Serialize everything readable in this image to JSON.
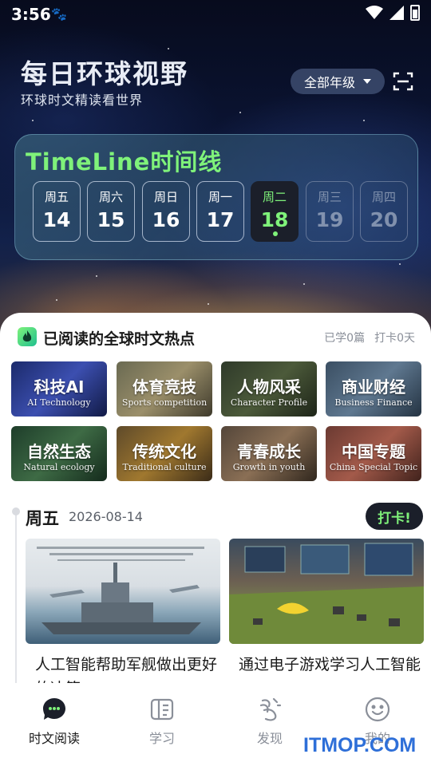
{
  "status_bar": {
    "time": "3:56"
  },
  "header": {
    "title": "每日环球视野",
    "subtitle": "环球时文精读看世界",
    "grade_select": "全部年级"
  },
  "timeline": {
    "title": "TimeLine时间线",
    "days": [
      {
        "weekday": "周五",
        "date": "14",
        "state": "past"
      },
      {
        "weekday": "周六",
        "date": "15",
        "state": "past"
      },
      {
        "weekday": "周日",
        "date": "16",
        "state": "past"
      },
      {
        "weekday": "周一",
        "date": "17",
        "state": "past"
      },
      {
        "weekday": "周二",
        "date": "18",
        "state": "active"
      },
      {
        "weekday": "周三",
        "date": "19",
        "state": "future"
      },
      {
        "weekday": "周四",
        "date": "20",
        "state": "future"
      }
    ]
  },
  "section": {
    "title": "已阅读的全球时文热点",
    "learned": "已学0篇",
    "checkin_days": "打卡0天"
  },
  "categories": [
    {
      "zh": "科技AI",
      "en": "AI Technology"
    },
    {
      "zh": "体育竞技",
      "en": "Sports competition"
    },
    {
      "zh": "人物风采",
      "en": "Character Profile"
    },
    {
      "zh": "商业财经",
      "en": "Business Finance"
    },
    {
      "zh": "自然生态",
      "en": "Natural ecology"
    },
    {
      "zh": "传统文化",
      "en": "Traditional culture"
    },
    {
      "zh": "青春成长",
      "en": "Growth in youth"
    },
    {
      "zh": "中国专题",
      "en": "China Special Topic"
    }
  ],
  "entry": {
    "weekday": "周五",
    "date": "2026-08-14",
    "checkin_label": "打卡!",
    "articles": [
      {
        "title": "人工智能帮助军舰做出更好的决策"
      },
      {
        "title": "通过电子游戏学习人工智能"
      }
    ]
  },
  "bottom_nav": [
    {
      "label": "时文阅读",
      "icon": "chat-bubble-icon",
      "active": true
    },
    {
      "label": "学习",
      "icon": "book-icon",
      "active": false
    },
    {
      "label": "发现",
      "icon": "discover-icon",
      "active": false
    },
    {
      "label": "我的",
      "icon": "smiley-icon",
      "active": false
    }
  ],
  "watermark": "ITMOP.COM",
  "colors": {
    "accent_green": "#7ff27a",
    "dark": "#1b1f2a"
  }
}
